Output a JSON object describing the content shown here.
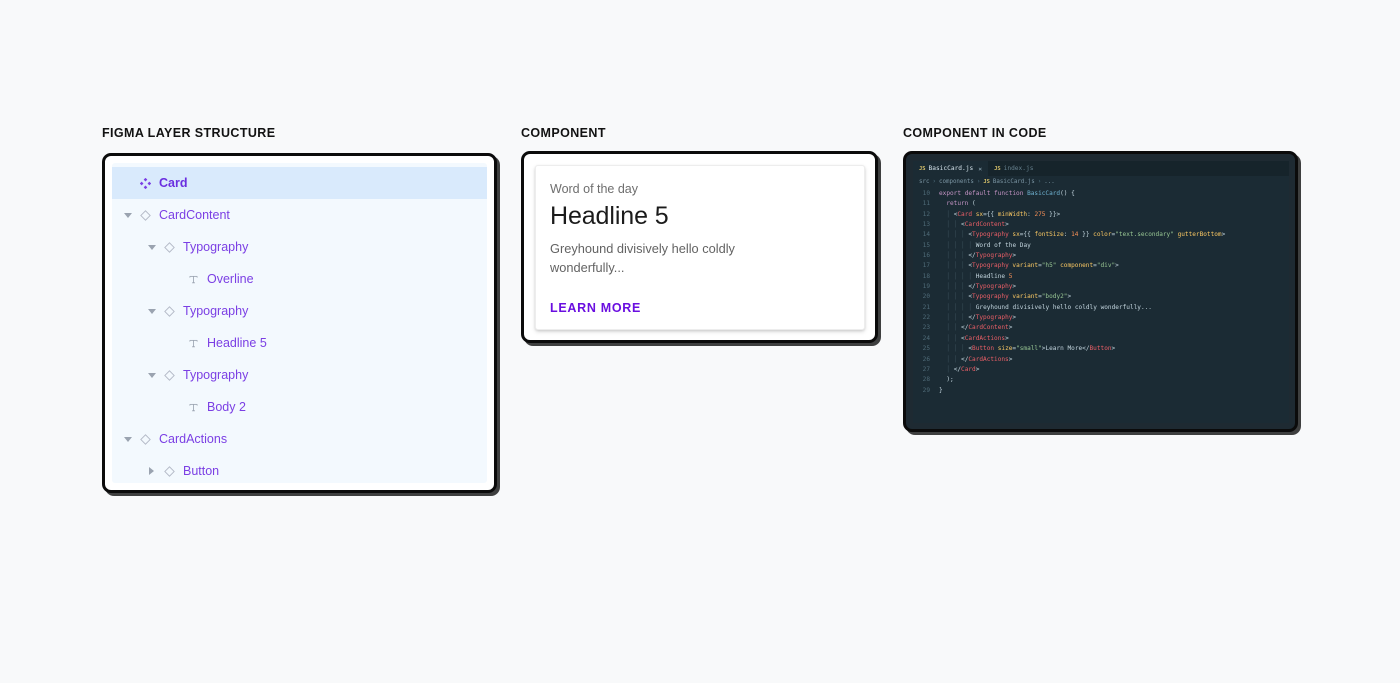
{
  "sections": {
    "layers_title": "FIGMA LAYER STRUCTURE",
    "component_title": "COMPONENT",
    "code_title": "COMPONENT IN CODE"
  },
  "layer_tree": {
    "rows": [
      {
        "label": "Card",
        "depth": 0,
        "caret": "none",
        "icon": "component-icon",
        "selected": true
      },
      {
        "label": "CardContent",
        "depth": 0,
        "caret": "down",
        "icon": "instance-icon",
        "selected": false
      },
      {
        "label": "Typography",
        "depth": 1,
        "caret": "down",
        "icon": "instance-icon",
        "selected": false
      },
      {
        "label": "Overline",
        "depth": 2,
        "caret": "none",
        "icon": "text-icon",
        "selected": false
      },
      {
        "label": "Typography",
        "depth": 1,
        "caret": "down",
        "icon": "instance-icon",
        "selected": false
      },
      {
        "label": "Headline 5",
        "depth": 2,
        "caret": "none",
        "icon": "text-icon",
        "selected": false
      },
      {
        "label": "Typography",
        "depth": 1,
        "caret": "down",
        "icon": "instance-icon",
        "selected": false
      },
      {
        "label": "Body 2",
        "depth": 2,
        "caret": "none",
        "icon": "text-icon",
        "selected": false
      },
      {
        "label": "CardActions",
        "depth": 0,
        "caret": "down",
        "icon": "instance-icon",
        "selected": false
      },
      {
        "label": "Button",
        "depth": 1,
        "caret": "right",
        "icon": "instance-icon",
        "selected": false
      }
    ]
  },
  "card": {
    "overline": "Word of the day",
    "headline": "Headline 5",
    "body": "Greyhound divisively hello coldly wonderfully...",
    "action_label": "LEARN MORE"
  },
  "editor": {
    "tabs": [
      {
        "label": "BasicCard.js",
        "badge": "JS",
        "active": true,
        "close": "×"
      },
      {
        "label": "index.js",
        "badge": "JS",
        "active": false,
        "close": ""
      }
    ],
    "breadcrumb": [
      {
        "text": "src",
        "badge": ""
      },
      {
        "text": "components",
        "badge": ""
      },
      {
        "text": "BasicCard.js",
        "badge": "JS"
      },
      {
        "text": "...",
        "badge": ""
      }
    ],
    "breadcrumb_separator": "›",
    "lines": [
      {
        "num": "10",
        "code": "export default function BasicCard() {"
      },
      {
        "num": "11",
        "code": "  return ("
      },
      {
        "num": "12",
        "code": "    <Card sx={{ minWidth: 275 }}>"
      },
      {
        "num": "13",
        "code": "      <CardContent>"
      },
      {
        "num": "14",
        "code": "        <Typography sx={{ fontSize: 14 }} color=\"text.secondary\" gutterBottom>"
      },
      {
        "num": "15",
        "code": "          Word of the Day"
      },
      {
        "num": "16",
        "code": "        </Typography>"
      },
      {
        "num": "17",
        "code": "        <Typography variant=\"h5\" component=\"div\">"
      },
      {
        "num": "18",
        "code": "          Headline 5"
      },
      {
        "num": "19",
        "code": "        </Typography>"
      },
      {
        "num": "20",
        "code": "        <Typography variant=\"body2\">"
      },
      {
        "num": "21",
        "code": "          Greyhound divisively hello coldly wonderfully..."
      },
      {
        "num": "22",
        "code": "        </Typography>"
      },
      {
        "num": "23",
        "code": "      </CardContent>"
      },
      {
        "num": "24",
        "code": "      <CardActions>"
      },
      {
        "num": "25",
        "code": "        <Button size=\"small\">Learn More</Button>"
      },
      {
        "num": "26",
        "code": "      </CardActions>"
      },
      {
        "num": "27",
        "code": "    </Card>"
      },
      {
        "num": "28",
        "code": "  );"
      },
      {
        "num": "29",
        "code": "}"
      }
    ]
  },
  "colors": {
    "page_background": "#f8f9fa",
    "frame_border": "#0b0b0b",
    "layer_panel_background": "#f3f9fe",
    "layer_selected_row": "#d9eafc",
    "layer_text": "#7b3fe4",
    "editor_background": "#1b2b34",
    "editor_chrome": "#16242b",
    "accent_purple": "#6a0ee0"
  }
}
